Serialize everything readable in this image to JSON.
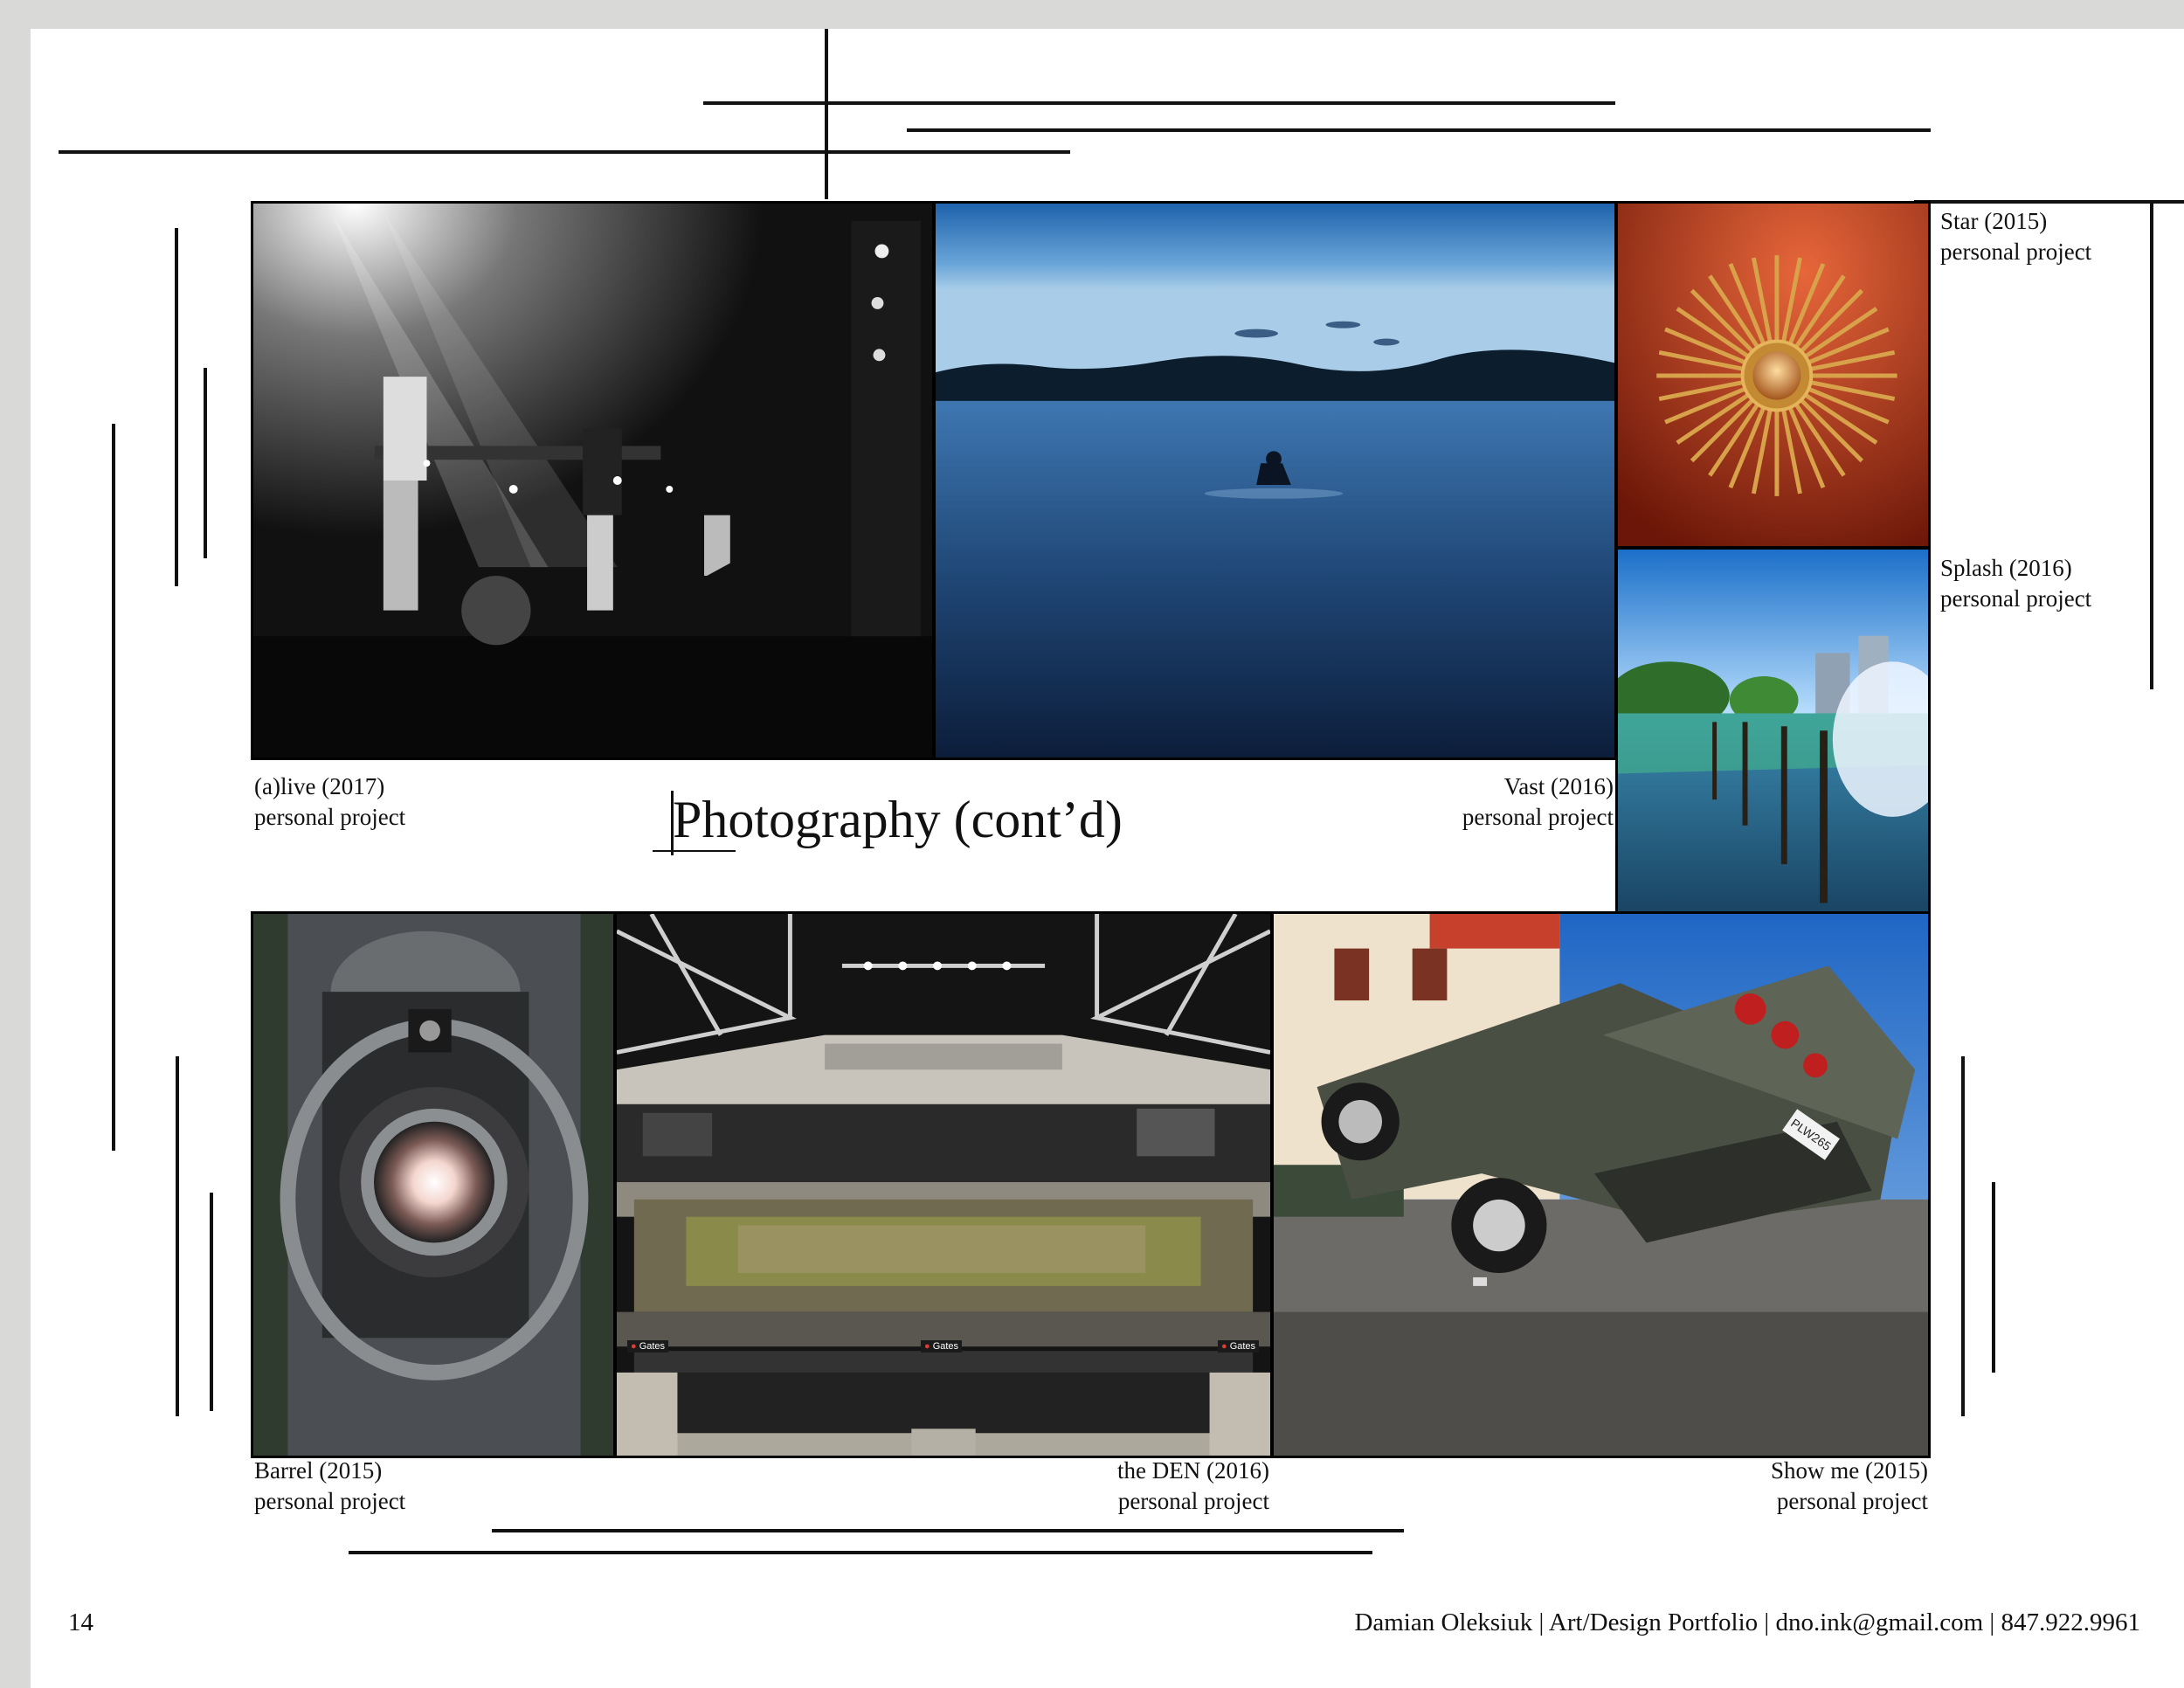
{
  "page_number": "14",
  "footer": "Damian Oleksiuk | Art/Design Portfolio | dno.ink@gmail.com | 847.922.9961",
  "title": "Photography (cont’d)",
  "photos": [
    {
      "title": "(a)live (2017)",
      "subtitle": "personal project"
    },
    {
      "title": "Vast (2016)",
      "subtitle": "personal project"
    },
    {
      "title": "Star (2015)",
      "subtitle": "personal project"
    },
    {
      "title": "Splash (2016)",
      "subtitle": "personal project"
    },
    {
      "title": "Barrel (2015)",
      "subtitle": "personal project"
    },
    {
      "title": "the DEN (2016)",
      "subtitle": "personal project"
    },
    {
      "title": "Show me (2015)",
      "subtitle": "personal project"
    }
  ],
  "den_signs": [
    "Gates",
    "Gates",
    "Gates"
  ],
  "license_plate": "PLW265"
}
